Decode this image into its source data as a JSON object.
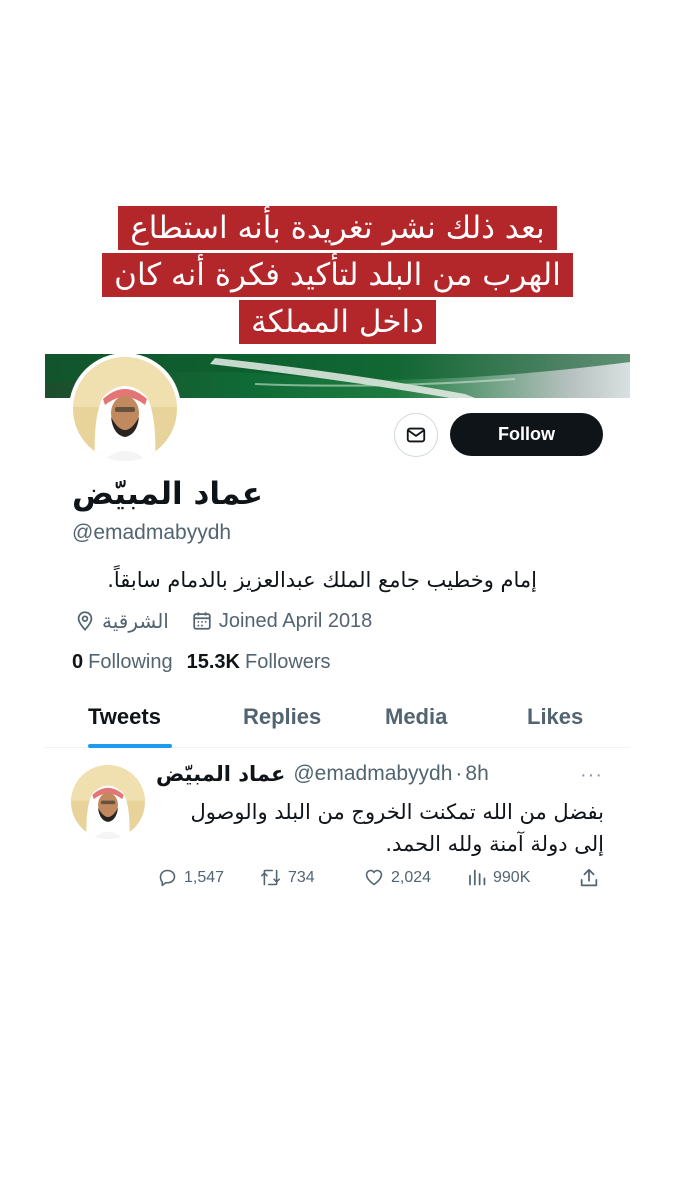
{
  "caption": {
    "lines": [
      "بعد ذلك نشر تغريدة بأنه استطاع",
      "الهرب من البلد لتأكيد فكرة أنه كان",
      "داخل المملكة"
    ]
  },
  "profile": {
    "name": "عماد المبيّض",
    "handle": "@emadmabyydh",
    "bio": "إمام وخطيب جامع الملك عبدالعزيز بالدمام سابقاً.",
    "location": "الشرقية",
    "joined": "Joined April 2018",
    "following_count": "0",
    "following_label": "Following",
    "followers_count": "15.3K",
    "followers_label": "Followers",
    "follow_button": "Follow",
    "banner_colors": [
      "#1d4d2c",
      "#0f6b35",
      "#d9e0e1"
    ]
  },
  "tabs": [
    {
      "label": "Tweets",
      "active": true
    },
    {
      "label": "Replies",
      "active": false
    },
    {
      "label": "Media",
      "active": false
    },
    {
      "label": "Likes",
      "active": false
    }
  ],
  "tweet": {
    "name": "عماد المبيّض",
    "handle": "@emadmabyydh",
    "separator": "·",
    "time": "8h",
    "more": "···",
    "text": "بفضل من الله تمكنت الخروج من البلد والوصول إلى دولة آمنة ولله الحمد.",
    "replies": "1,547",
    "retweets": "734",
    "likes": "2,024",
    "views": "990K"
  },
  "colors": {
    "caption_bg": "#b3262a",
    "accent": "#1d9bf0",
    "text_secondary": "#536471",
    "follow_bg": "#0f1419"
  }
}
